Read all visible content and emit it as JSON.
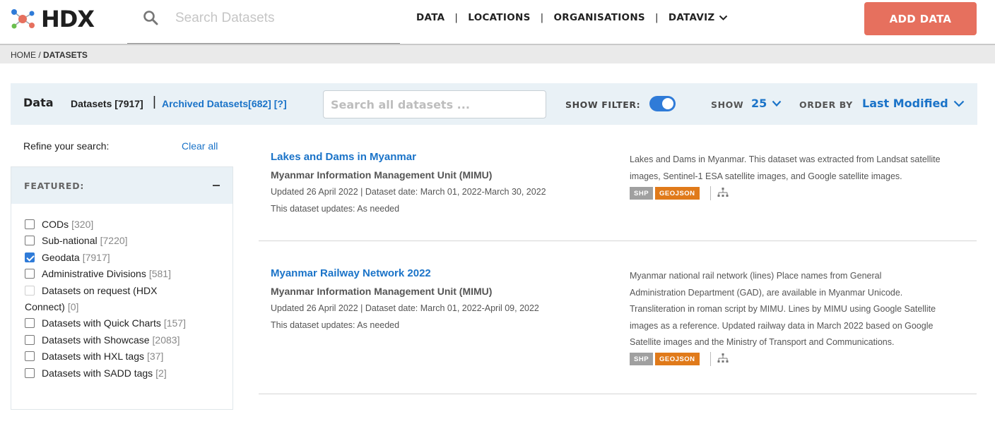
{
  "header": {
    "logo_text": "HDX",
    "search_placeholder": "Search Datasets",
    "nav": [
      {
        "label": "DATA"
      },
      {
        "label": "LOCATIONS"
      },
      {
        "label": "ORGANISATIONS"
      },
      {
        "label": "DATAVIZ"
      }
    ],
    "nav_separator": "|",
    "add_data_label": "ADD DATA",
    "accent_color": "#e6705e"
  },
  "breadcrumb": {
    "home": "HOME",
    "separator": " / ",
    "current": "DATASETS"
  },
  "toolbar": {
    "title": "Data",
    "datasets_label": "Datasets [7917]",
    "pipe": "|",
    "archived_label": "Archived Datasets[682] [?]",
    "search_placeholder": "Search all datasets ...",
    "show_filter_label": "SHOW FILTER:",
    "show_filter_on": true,
    "show_label": "SHOW",
    "show_value": "25",
    "order_label": "ORDER BY",
    "order_value": "Last Modified",
    "link_color": "#1a73c8"
  },
  "filters": {
    "refine_label": "Refine your search:",
    "clear_all": "Clear all",
    "section_title": "FEATURED:",
    "items": [
      {
        "label": "CODs",
        "count": "[320]",
        "checked": false
      },
      {
        "label": "Sub-national",
        "count": "[7220]",
        "checked": false
      },
      {
        "label": "Geodata",
        "count": "[7917]",
        "checked": true
      },
      {
        "label": "Administrative Divisions",
        "count": "[581]",
        "checked": false
      },
      {
        "label_line1": "Datasets on request (HDX",
        "label_line2": "Connect)",
        "count": "[0]",
        "checked": false,
        "disabled": true
      },
      {
        "label": "Datasets with Quick Charts",
        "count": "[157]",
        "checked": false
      },
      {
        "label": "Datasets with Showcase",
        "count": "[2083]",
        "checked": false
      },
      {
        "label": "Datasets with HXL tags",
        "count": "[37]",
        "checked": false
      },
      {
        "label": "Datasets with SADD tags",
        "count": "[2]",
        "checked": false
      }
    ]
  },
  "datasets": [
    {
      "title": "Lakes and Dams in Myanmar",
      "organisation": "Myanmar Information Management Unit (MIMU)",
      "updated": "Updated 26 April 2022 | Dataset date: March 01, 2022-March 30, 2022",
      "frequency": "This dataset updates: As needed",
      "description_lines": [
        "Lakes and Dams in Myanmar. This dataset was extracted from Landsat satellite",
        "images, Sentinel-1 ESA satellite images, and Google satellite images."
      ],
      "formats": [
        "SHP",
        "GEOJSON"
      ]
    },
    {
      "title": "Myanmar Railway Network 2022",
      "organisation": "Myanmar Information Management Unit (MIMU)",
      "updated": "Updated 26 April 2022 | Dataset date: March 01, 2022-April 09, 2022",
      "frequency": "This dataset updates: As needed",
      "description_lines": [
        "Myanmar national rail network (lines) Place names from General",
        "Administration Department (GAD), are available in Myanmar Unicode.",
        "Transliteration in roman script by MIMU. Lines by MIMU using Google Satellite",
        "images as a reference. Updated railway data in March 2022 based on Google",
        "Satellite images and the Ministry of Transport and Communications."
      ],
      "formats": [
        "SHP",
        "GEOJSON"
      ]
    }
  ]
}
